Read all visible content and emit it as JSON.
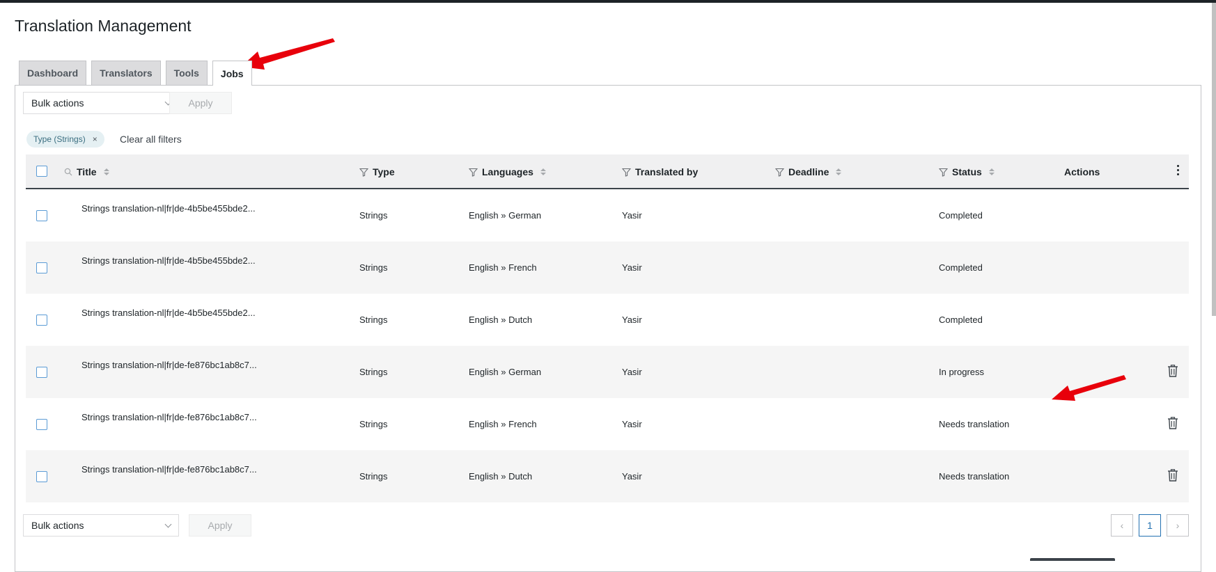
{
  "page": {
    "title": "Translation Management"
  },
  "tabs": [
    {
      "label": "Dashboard",
      "active": false
    },
    {
      "label": "Translators",
      "active": false
    },
    {
      "label": "Tools",
      "active": false
    },
    {
      "label": "Jobs",
      "active": true
    }
  ],
  "bulk": {
    "select_label": "Bulk actions",
    "apply_label": "Apply"
  },
  "filters": {
    "chip_label": "Type (Strings)",
    "chip_remove": "×",
    "clear_label": "Clear all filters"
  },
  "columns": {
    "title": "Title",
    "type": "Type",
    "languages": "Languages",
    "translated_by": "Translated by",
    "deadline": "Deadline",
    "status": "Status",
    "actions": "Actions"
  },
  "rows": [
    {
      "title": "Strings translation-nl|fr|de-4b5be455bde2...",
      "type": "Strings",
      "languages": "English » German",
      "translated_by": "Yasir",
      "deadline": "",
      "status": "Completed",
      "deletable": false
    },
    {
      "title": "Strings translation-nl|fr|de-4b5be455bde2...",
      "type": "Strings",
      "languages": "English » French",
      "translated_by": "Yasir",
      "deadline": "",
      "status": "Completed",
      "deletable": false
    },
    {
      "title": "Strings translation-nl|fr|de-4b5be455bde2...",
      "type": "Strings",
      "languages": "English » Dutch",
      "translated_by": "Yasir",
      "deadline": "",
      "status": "Completed",
      "deletable": false
    },
    {
      "title": "Strings translation-nl|fr|de-fe876bc1ab8c7...",
      "type": "Strings",
      "languages": "English » German",
      "translated_by": "Yasir",
      "deadline": "",
      "status": "In progress",
      "deletable": true
    },
    {
      "title": "Strings translation-nl|fr|de-fe876bc1ab8c7...",
      "type": "Strings",
      "languages": "English » French",
      "translated_by": "Yasir",
      "deadline": "",
      "status": "Needs translation",
      "deletable": true
    },
    {
      "title": "Strings translation-nl|fr|de-fe876bc1ab8c7...",
      "type": "Strings",
      "languages": "English » Dutch",
      "translated_by": "Yasir",
      "deadline": "",
      "status": "Needs translation",
      "deletable": true
    }
  ],
  "pagination": {
    "prev": "‹",
    "current": "1",
    "next": "›"
  },
  "colors": {
    "annotation_arrow": "#e8000b",
    "accent": "#2271b1"
  }
}
